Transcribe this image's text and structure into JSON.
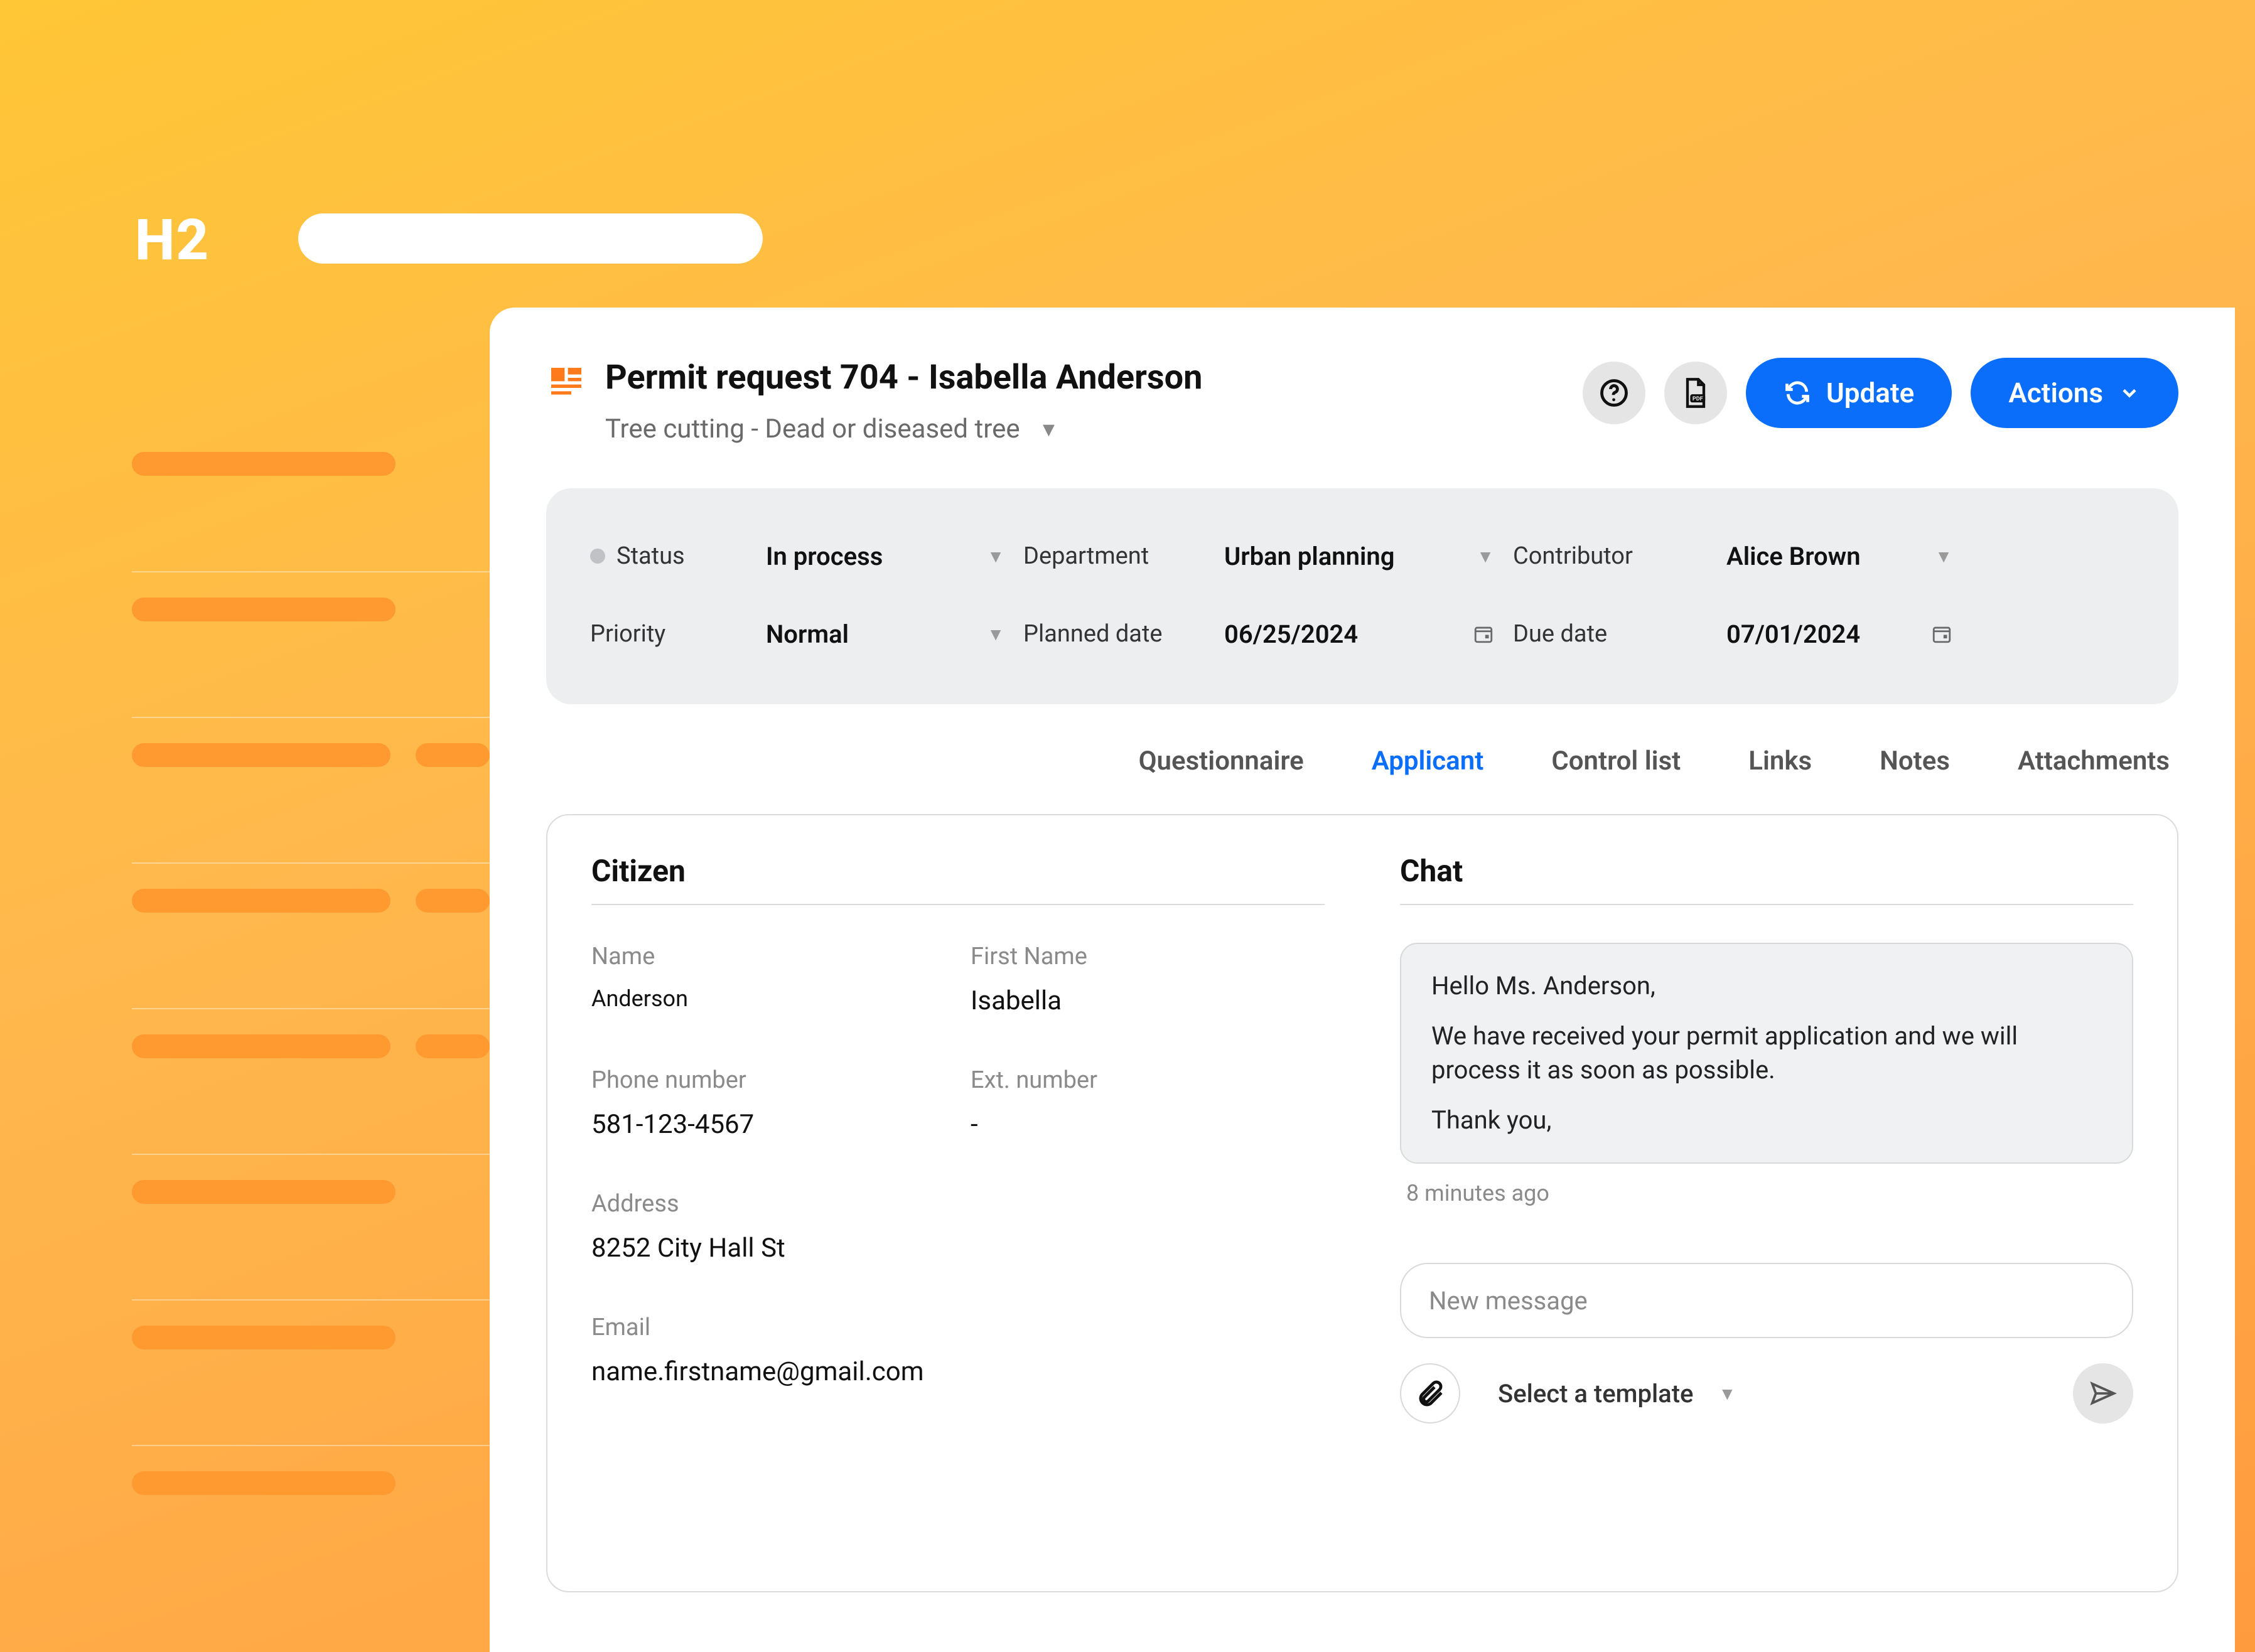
{
  "decor": {
    "h2_label": "H2"
  },
  "header": {
    "title": "Permit request 704 - Isabella Anderson",
    "subtitle": "Tree cutting - Dead or diseased tree",
    "update_label": "Update",
    "actions_label": "Actions"
  },
  "status": {
    "status_label": "Status",
    "status_value": "In process",
    "department_label": "Department",
    "department_value": "Urban planning",
    "contributor_label": "Contributor",
    "contributor_value": "Alice Brown",
    "priority_label": "Priority",
    "priority_value": "Normal",
    "planned_label": "Planned date",
    "planned_value": "06/25/2024",
    "due_label": "Due date",
    "due_value": "07/01/2024"
  },
  "tabs": {
    "questionnaire": "Questionnaire",
    "applicant": "Applicant",
    "control_list": "Control list",
    "links": "Links",
    "notes": "Notes",
    "attachments": "Attachments"
  },
  "citizen": {
    "section_title": "Citizen",
    "name_label": "Name",
    "name_value": "Anderson",
    "first_name_label": "First Name",
    "first_name_value": "Isabella",
    "phone_label": "Phone number",
    "phone_value": "581-123-4567",
    "ext_label": "Ext. number",
    "ext_value": "-",
    "address_label": "Address",
    "address_value": "8252 City Hall St",
    "email_label": "Email",
    "email_value": "name.firstname@gmail.com"
  },
  "chat": {
    "section_title": "Chat",
    "bubble_line1": "Hello Ms. Anderson,",
    "bubble_line2": "We have received your permit application and we will process it as soon as possible.",
    "bubble_line3": "Thank you,",
    "timestamp": "8 minutes ago",
    "input_placeholder": "New message",
    "template_label": "Select a template"
  }
}
